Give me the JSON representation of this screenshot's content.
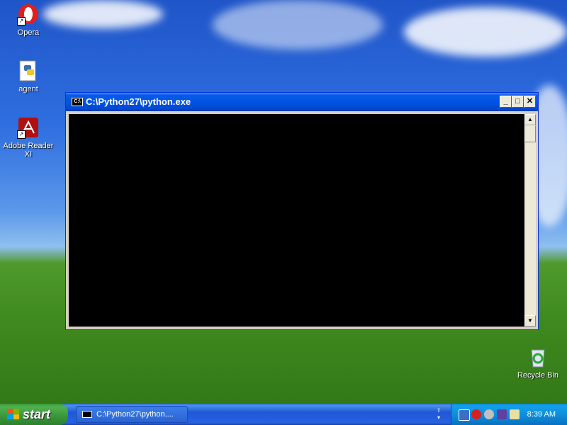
{
  "desktop": {
    "icons": [
      {
        "label": "Opera"
      },
      {
        "label": "agent"
      },
      {
        "label": "Adobe Reader XI"
      },
      {
        "label": "Recycle Bin"
      }
    ]
  },
  "window": {
    "title": "C:\\Python27\\python.exe",
    "icon": "console-icon",
    "minimize_glyph": "_",
    "maximize_glyph": "□",
    "close_glyph": "✕",
    "scroll_up_glyph": "▲",
    "scroll_down_glyph": "▼"
  },
  "taskbar": {
    "start_label": "start",
    "task_item_label": "C:\\Python27\\python....",
    "clock": "8:39 AM",
    "colors": {
      "taskbar": "#245edb",
      "start": "#3c9a3c",
      "tray": "#0f8ad8"
    }
  }
}
